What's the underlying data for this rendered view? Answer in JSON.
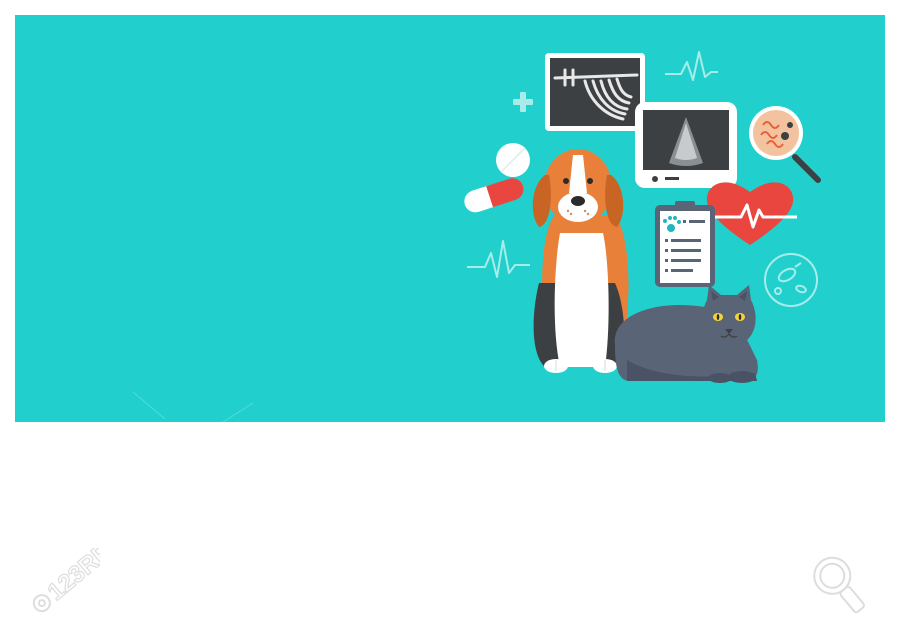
{
  "image": {
    "banner_color": "#21d0cd",
    "background_color": "#ffffff"
  },
  "illustration": {
    "subjects": [
      "beagle-dog",
      "grey-cat"
    ],
    "icons": [
      "plus-icon",
      "capsule-pill-icon",
      "xray-icon",
      "ultrasound-monitor-icon",
      "magnifier-icon",
      "heart-pulse-icon",
      "clipboard-icon",
      "bacteria-icon",
      "pulse-line-icon"
    ],
    "colors": {
      "dog_orange": "#e8803a",
      "cat_grey": "#5a6477",
      "heart_red": "#e8463f",
      "xray_dark": "#3d4043",
      "paw_teal": "#1fb6c0"
    }
  },
  "watermark": {
    "logo_text": "123RF",
    "color": "#dddddd"
  }
}
